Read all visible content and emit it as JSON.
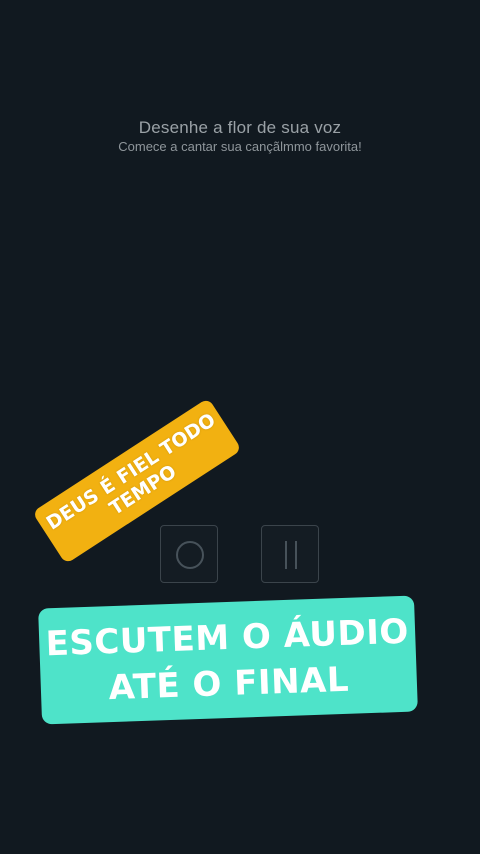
{
  "screen": {
    "title": "Desenhe a flor de sua voz",
    "subtitle": "Comece a cantar sua cançãlmmo favorita!"
  },
  "controls": {
    "record_icon": "record-circle-icon",
    "pause_icon": "pause-icon"
  },
  "overlay": {
    "yellow_sticker_line1": "DEUS É FIEL TODO",
    "yellow_sticker_line2": "TEMPO",
    "teal_sticker_line1": "ESCUTEM O ÁUDIO",
    "teal_sticker_line2": "ATÉ O FINAL"
  },
  "colors": {
    "background": "#111920",
    "yellow_sticker": "#f2b111",
    "teal_sticker": "#4ee3c9"
  }
}
